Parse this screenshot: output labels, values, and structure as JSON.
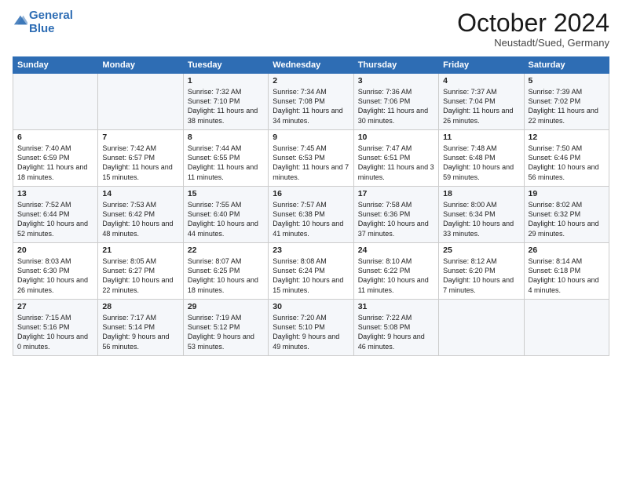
{
  "logo": {
    "line1": "General",
    "line2": "Blue"
  },
  "header": {
    "month": "October 2024",
    "location": "Neustadt/Sued, Germany"
  },
  "days_header": [
    "Sunday",
    "Monday",
    "Tuesday",
    "Wednesday",
    "Thursday",
    "Friday",
    "Saturday"
  ],
  "weeks": [
    [
      {
        "day": "",
        "info": ""
      },
      {
        "day": "",
        "info": ""
      },
      {
        "day": "1",
        "sunrise": "7:32 AM",
        "sunset": "7:10 PM",
        "daylight": "11 hours and 38 minutes."
      },
      {
        "day": "2",
        "sunrise": "7:34 AM",
        "sunset": "7:08 PM",
        "daylight": "11 hours and 34 minutes."
      },
      {
        "day": "3",
        "sunrise": "7:36 AM",
        "sunset": "7:06 PM",
        "daylight": "11 hours and 30 minutes."
      },
      {
        "day": "4",
        "sunrise": "7:37 AM",
        "sunset": "7:04 PM",
        "daylight": "11 hours and 26 minutes."
      },
      {
        "day": "5",
        "sunrise": "7:39 AM",
        "sunset": "7:02 PM",
        "daylight": "11 hours and 22 minutes."
      }
    ],
    [
      {
        "day": "6",
        "sunrise": "7:40 AM",
        "sunset": "6:59 PM",
        "daylight": "11 hours and 18 minutes."
      },
      {
        "day": "7",
        "sunrise": "7:42 AM",
        "sunset": "6:57 PM",
        "daylight": "11 hours and 15 minutes."
      },
      {
        "day": "8",
        "sunrise": "7:44 AM",
        "sunset": "6:55 PM",
        "daylight": "11 hours and 11 minutes."
      },
      {
        "day": "9",
        "sunrise": "7:45 AM",
        "sunset": "6:53 PM",
        "daylight": "11 hours and 7 minutes."
      },
      {
        "day": "10",
        "sunrise": "7:47 AM",
        "sunset": "6:51 PM",
        "daylight": "11 hours and 3 minutes."
      },
      {
        "day": "11",
        "sunrise": "7:48 AM",
        "sunset": "6:48 PM",
        "daylight": "10 hours and 59 minutes."
      },
      {
        "day": "12",
        "sunrise": "7:50 AM",
        "sunset": "6:46 PM",
        "daylight": "10 hours and 56 minutes."
      }
    ],
    [
      {
        "day": "13",
        "sunrise": "7:52 AM",
        "sunset": "6:44 PM",
        "daylight": "10 hours and 52 minutes."
      },
      {
        "day": "14",
        "sunrise": "7:53 AM",
        "sunset": "6:42 PM",
        "daylight": "10 hours and 48 minutes."
      },
      {
        "day": "15",
        "sunrise": "7:55 AM",
        "sunset": "6:40 PM",
        "daylight": "10 hours and 44 minutes."
      },
      {
        "day": "16",
        "sunrise": "7:57 AM",
        "sunset": "6:38 PM",
        "daylight": "10 hours and 41 minutes."
      },
      {
        "day": "17",
        "sunrise": "7:58 AM",
        "sunset": "6:36 PM",
        "daylight": "10 hours and 37 minutes."
      },
      {
        "day": "18",
        "sunrise": "8:00 AM",
        "sunset": "6:34 PM",
        "daylight": "10 hours and 33 minutes."
      },
      {
        "day": "19",
        "sunrise": "8:02 AM",
        "sunset": "6:32 PM",
        "daylight": "10 hours and 29 minutes."
      }
    ],
    [
      {
        "day": "20",
        "sunrise": "8:03 AM",
        "sunset": "6:30 PM",
        "daylight": "10 hours and 26 minutes."
      },
      {
        "day": "21",
        "sunrise": "8:05 AM",
        "sunset": "6:27 PM",
        "daylight": "10 hours and 22 minutes."
      },
      {
        "day": "22",
        "sunrise": "8:07 AM",
        "sunset": "6:25 PM",
        "daylight": "10 hours and 18 minutes."
      },
      {
        "day": "23",
        "sunrise": "8:08 AM",
        "sunset": "6:24 PM",
        "daylight": "10 hours and 15 minutes."
      },
      {
        "day": "24",
        "sunrise": "8:10 AM",
        "sunset": "6:22 PM",
        "daylight": "10 hours and 11 minutes."
      },
      {
        "day": "25",
        "sunrise": "8:12 AM",
        "sunset": "6:20 PM",
        "daylight": "10 hours and 7 minutes."
      },
      {
        "day": "26",
        "sunrise": "8:14 AM",
        "sunset": "6:18 PM",
        "daylight": "10 hours and 4 minutes."
      }
    ],
    [
      {
        "day": "27",
        "sunrise": "7:15 AM",
        "sunset": "5:16 PM",
        "daylight": "10 hours and 0 minutes."
      },
      {
        "day": "28",
        "sunrise": "7:17 AM",
        "sunset": "5:14 PM",
        "daylight": "9 hours and 56 minutes."
      },
      {
        "day": "29",
        "sunrise": "7:19 AM",
        "sunset": "5:12 PM",
        "daylight": "9 hours and 53 minutes."
      },
      {
        "day": "30",
        "sunrise": "7:20 AM",
        "sunset": "5:10 PM",
        "daylight": "9 hours and 49 minutes."
      },
      {
        "day": "31",
        "sunrise": "7:22 AM",
        "sunset": "5:08 PM",
        "daylight": "9 hours and 46 minutes."
      },
      {
        "day": "",
        "info": ""
      },
      {
        "day": "",
        "info": ""
      }
    ]
  ]
}
